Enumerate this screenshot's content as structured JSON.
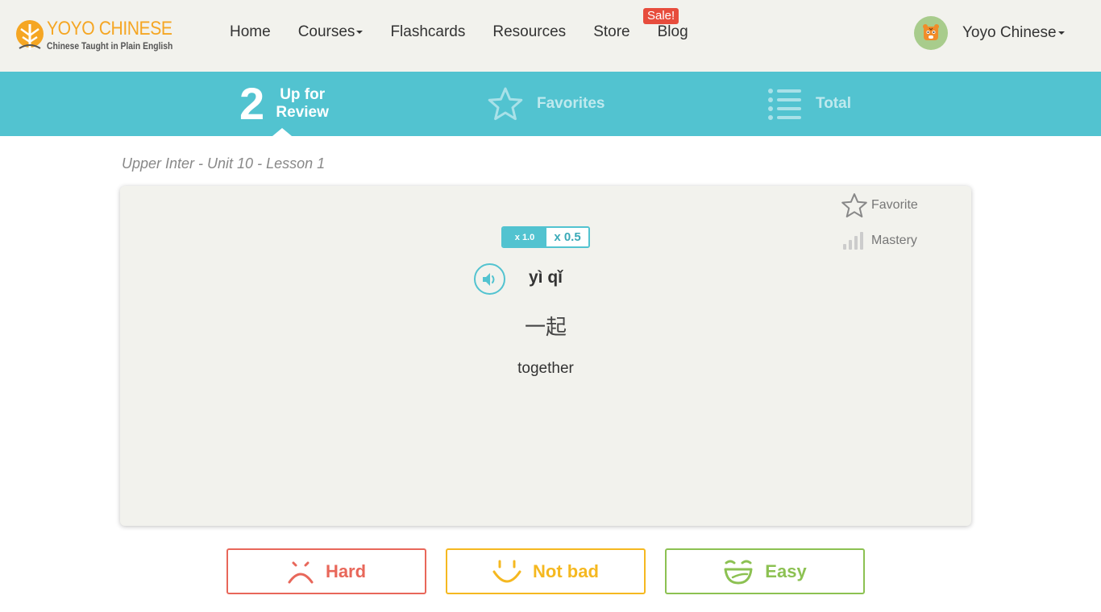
{
  "header": {
    "logo_title": "YOYO CHINESE",
    "logo_subtitle": "Chinese Taught in Plain English",
    "nav": [
      {
        "label": "Home",
        "dropdown": false
      },
      {
        "label": "Courses",
        "dropdown": true
      },
      {
        "label": "Flashcards",
        "dropdown": false
      },
      {
        "label": "Resources",
        "dropdown": false
      },
      {
        "label": "Store",
        "dropdown": false
      },
      {
        "label": "Blog",
        "dropdown": false
      }
    ],
    "sale_badge": "Sale!",
    "user_name": "Yoyo Chinese"
  },
  "tabs": {
    "review_count": "2",
    "review_label_line1": "Up for",
    "review_label_line2": "Review",
    "favorites_label": "Favorites",
    "total_label": "Total"
  },
  "lesson_title": "Upper Inter - Unit 10 - Lesson 1",
  "card": {
    "favorite_label": "Favorite",
    "mastery_label": "Mastery",
    "speed_options": [
      "x 1.0",
      "x 0.5"
    ],
    "pinyin": "yì qǐ",
    "hanzi": "一起",
    "meaning": "together"
  },
  "rating": {
    "hard_label": "Hard",
    "not_bad_label": "Not bad",
    "easy_label": "Easy"
  },
  "colors": {
    "accent": "#52c3d0",
    "logo": "#f5a623",
    "hard": "#e8675a",
    "not_bad": "#f5b820",
    "easy": "#8cc152",
    "sale": "#e74c3c"
  }
}
